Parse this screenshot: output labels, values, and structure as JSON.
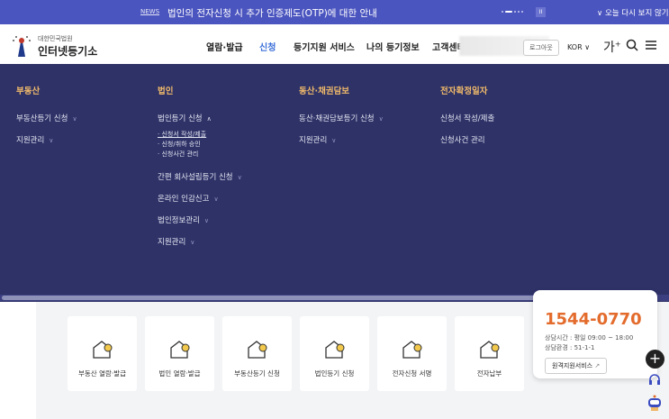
{
  "banner": {
    "tag": "NEWS",
    "message": "법인의 전자신청 시 추가 인증제도(OTP)에 대한 안내",
    "pause": "II",
    "close": "오늘 다시 보지 않기"
  },
  "header": {
    "logo_sub": "대한민국법원",
    "logo_title": "인터넷등기소",
    "nav": [
      "열람·발급",
      "신청",
      "등기지원 서비스",
      "나의 등기정보",
      "고객센터"
    ],
    "logout": "로그아웃",
    "lang": "KOR",
    "font_size": "가"
  },
  "mega": {
    "columns": [
      {
        "title": "부동산",
        "items": [
          {
            "label": "부동산등기 신청"
          },
          {
            "label": "지원관리"
          }
        ]
      },
      {
        "title": "법인",
        "items": [
          {
            "label": "법인등기 신청",
            "subs": [
              "신청서 작성/제출",
              "신청/취하 승인",
              "신청사건 관리"
            ]
          },
          {
            "label": "간편 회사설립등기 신청"
          },
          {
            "label": "온라인 인감신고"
          },
          {
            "label": "법인정보관리"
          },
          {
            "label": "지원관리"
          }
        ]
      },
      {
        "title": "동산·채권담보",
        "items": [
          {
            "label": "동산·채권담보등기 신청"
          },
          {
            "label": "지원관리"
          }
        ]
      },
      {
        "title": "전자확정일자",
        "items": [
          {
            "label": "신청서 작성/제출"
          },
          {
            "label": "신청사건 관리"
          }
        ]
      }
    ]
  },
  "quick": [
    "부동산 열람·발급",
    "법인 열람·발급",
    "부동산등기 신청",
    "법인등기 신청",
    "전자신청 서명",
    "전자납부"
  ],
  "support": {
    "phone": "1544-0770",
    "hours": "상담시간 : 평일 09:00 ~ 18:00",
    "env": "상담환경 : 51-1-1",
    "remote": "원격지원서비스"
  },
  "colors": {
    "banner": "#4b55bf",
    "mega": "#2e3267",
    "accent": "#f0b96a",
    "phone": "#e36b2c"
  }
}
